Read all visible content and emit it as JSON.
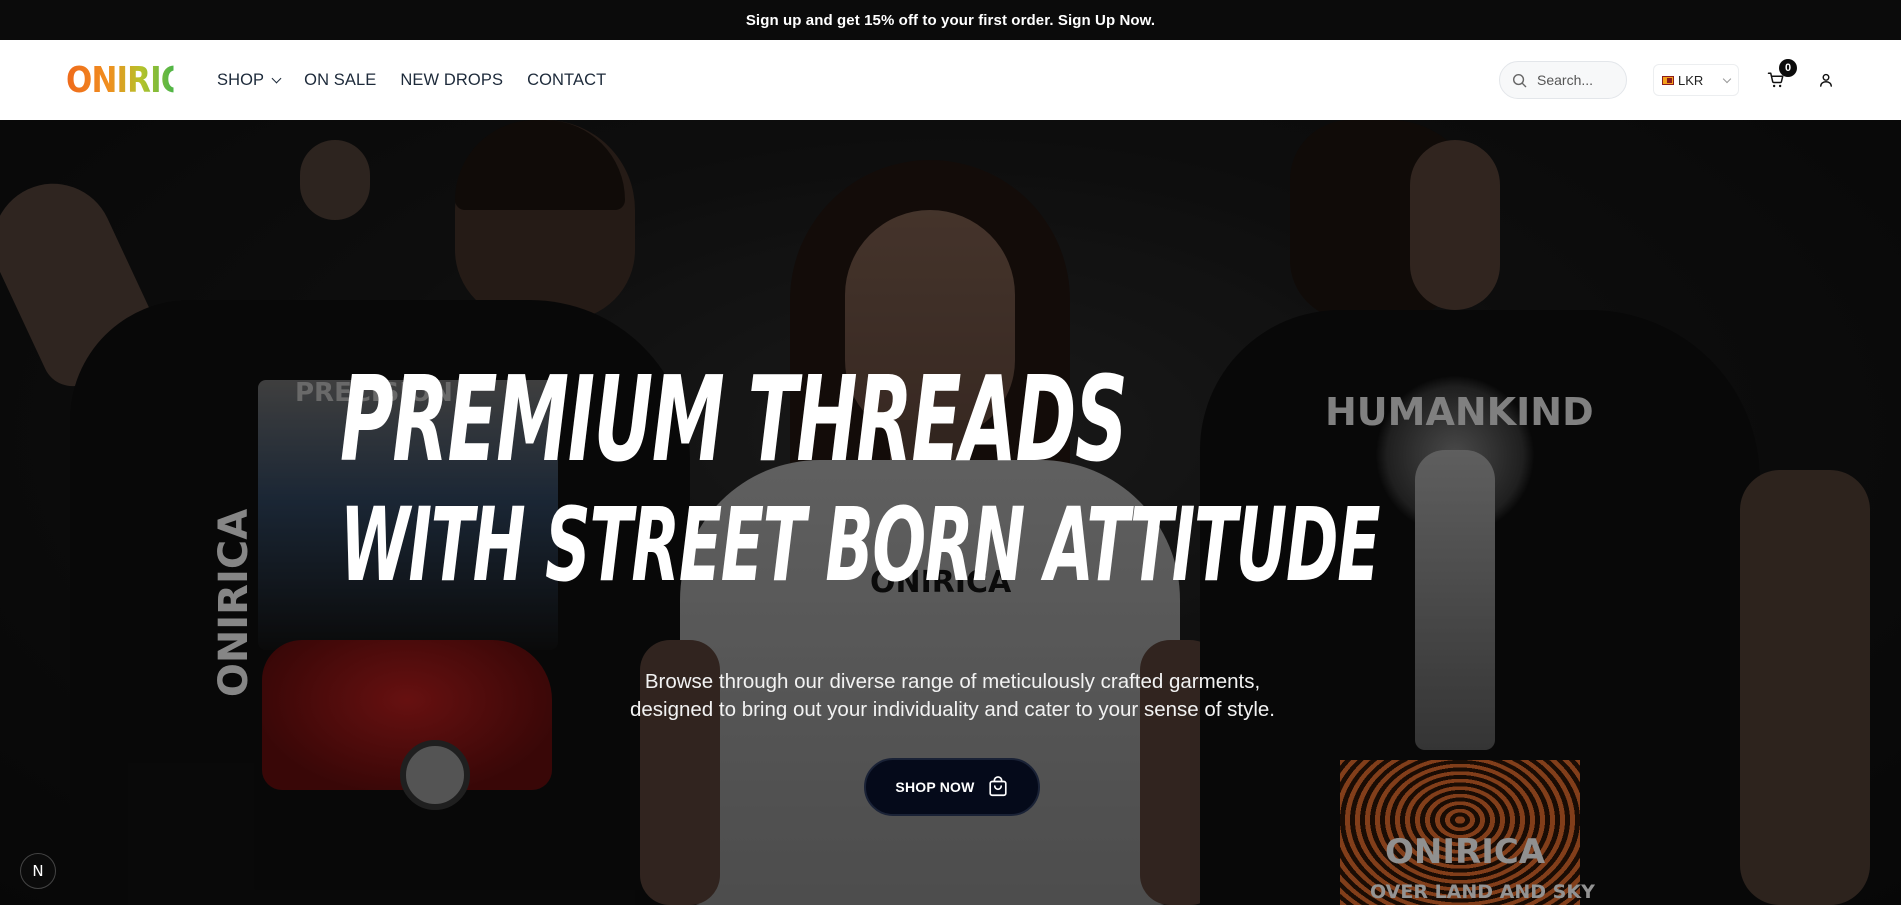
{
  "announcement": {
    "text": "Sign up and get 15% off to your first order. Sign Up Now."
  },
  "header": {
    "logo": "ONIRICA",
    "nav": [
      {
        "label": "SHOP",
        "has_dropdown": true
      },
      {
        "label": "ON SALE"
      },
      {
        "label": "NEW DROPS"
      },
      {
        "label": "CONTACT"
      }
    ],
    "search_placeholder": "Search...",
    "currency": "LKR",
    "cart_count": "0"
  },
  "hero": {
    "title_line1": "PREMIUM THREADS",
    "title_line2": "WITH STREET BORN ATTITUDE",
    "subtitle_line1": "Browse through our diverse range of meticulously crafted garments,",
    "subtitle_line2": "designed to bring out your individuality and cater to your sense of style.",
    "cta_label": "SHOP NOW",
    "shirt_prints": {
      "left_vertical": "ONIRICA",
      "left_top": "PRECISION",
      "center": "ONIRICA",
      "right_top": "HUMANKIND",
      "right_bottom": "ONIRICA",
      "right_footer": "OVER LAND AND SKY"
    }
  },
  "dev_badge": "N",
  "colors": {
    "announcement_bg": "#0b0b0b",
    "cta_bg": "#050a1a",
    "logo_gradient": [
      "#ef6a1c",
      "#b5c22b",
      "#4eb548"
    ]
  },
  "icons": [
    "search-icon",
    "chevron-down-icon",
    "cart-icon",
    "user-icon",
    "shopping-bag-icon",
    "lk-flag-icon"
  ]
}
